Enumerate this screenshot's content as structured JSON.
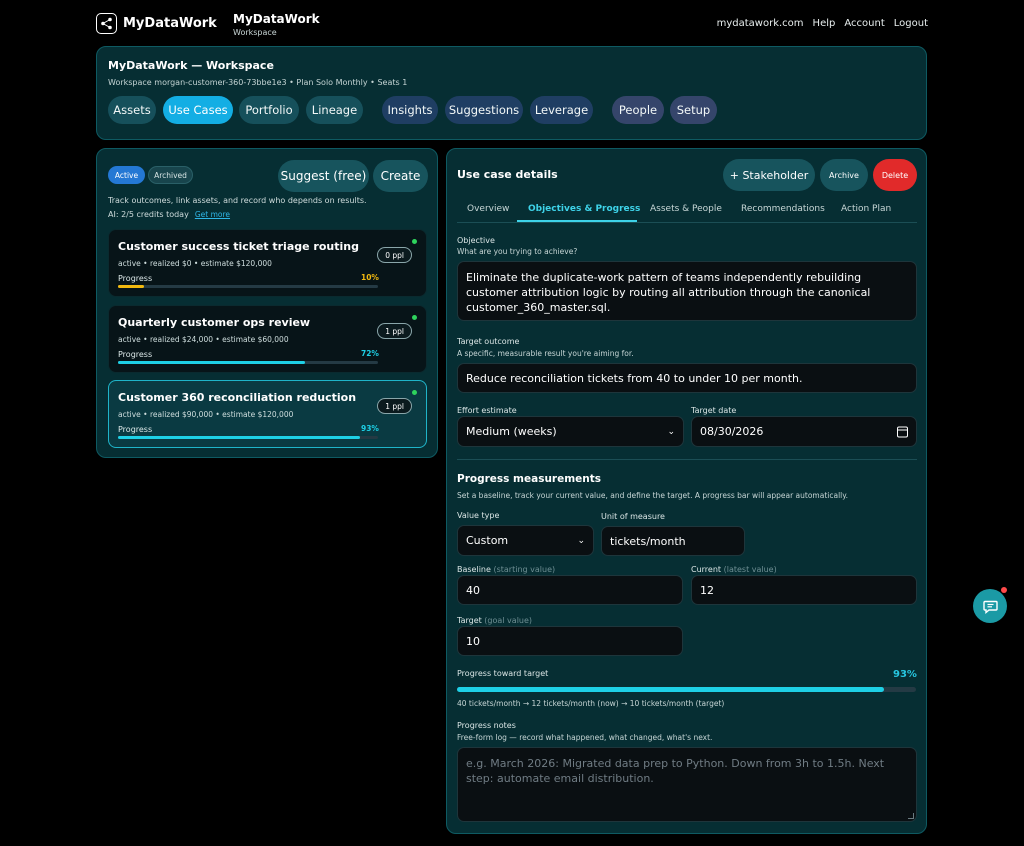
{
  "app": {
    "logo_text": "MyDataWork",
    "brand_title": "MyDataWork",
    "brand_sub": "Workspace"
  },
  "topnav": [
    "mydatawork.com",
    "Help",
    "Account",
    "Logout"
  ],
  "workspace": {
    "title": "MyDataWork — Workspace",
    "meta": "Workspace morgan-customer-360-73bbe1e3 • Plan Solo Monthly • Seats 1",
    "tabs": [
      "Assets",
      "Use Cases",
      "Portfolio",
      "Lineage",
      "Insights",
      "Suggestions",
      "Leverage",
      "People",
      "Setup"
    ],
    "active_tab": "Use Cases"
  },
  "left": {
    "chip_active": "Active",
    "chip_archived": "Archived",
    "suggest_label": "Suggest (free)",
    "create_label": "Create",
    "help_text": "Track outcomes, link assets, and record who depends on results.",
    "credits_text": "AI: 2/5 credits today",
    "get_more": "Get more",
    "cards": [
      {
        "title": "Customer success ticket triage routing",
        "sub": "active • realized $0 • estimate $120,000",
        "progress_label": "Progress",
        "pct_label": "10%",
        "progress": 0.1,
        "ppl": "0 ppl",
        "color": "#f2b90f"
      },
      {
        "title": "Quarterly customer ops review",
        "sub": "active • realized $24,000 • estimate $60,000",
        "progress_label": "Progress",
        "pct_label": "72%",
        "progress": 0.72,
        "ppl": "1 ppl",
        "color": "#1ed0e6"
      },
      {
        "title": "Customer 360 reconciliation reduction",
        "sub": "active • realized $90,000 • estimate $120,000",
        "progress_label": "Progress",
        "pct_label": "93%",
        "progress": 0.93,
        "ppl": "1 ppl",
        "color": "#1ed0e6"
      }
    ]
  },
  "details": {
    "title": "Use case details",
    "stakeholder_label": "+ Stakeholder",
    "archive_label": "Archive",
    "delete_label": "Delete",
    "subtabs": [
      "Overview",
      "Objectives & Progress",
      "Assets & People",
      "Recommendations",
      "Action Plan"
    ],
    "active_subtab": "Objectives & Progress",
    "objective_label": "Objective",
    "objective_help": "What are you trying to achieve?",
    "objective_value": "Eliminate the duplicate-work pattern of teams independently rebuilding customer attribution logic by routing all attribution through the canonical customer_360_master.sql.",
    "target_outcome_label": "Target outcome",
    "target_outcome_help": "A specific, measurable result you're aiming for.",
    "target_outcome_value": "Reduce reconciliation tickets from 40 to under 10 per month.",
    "effort_label": "Effort estimate",
    "effort_value": "Medium (weeks)",
    "target_date_label": "Target date",
    "target_date_value": "08/30/2026",
    "progress_title": "Progress measurements",
    "progress_help": "Set a baseline, track your current value, and define the target. A progress bar will appear automatically.",
    "value_type_label": "Value type",
    "value_type_value": "Custom",
    "unit_label": "Unit of measure",
    "unit_value": "tickets/month",
    "baseline_label": "Baseline",
    "baseline_hint": "(starting value)",
    "baseline_value": "40",
    "current_label": "Current",
    "current_hint": "(latest value)",
    "current_value": "12",
    "target_label": "Target",
    "target_hint": "(goal value)",
    "target_value": "10",
    "toward_label": "Progress toward target",
    "toward_pct_label": "93%",
    "toward_progress": 0.93,
    "toward_summary": "40 tickets/month → 12 tickets/month (now) → 10 tickets/month (target)",
    "notes_label": "Progress notes",
    "notes_help": "Free-form log — record what happened, what changed, what's next.",
    "notes_placeholder": "e.g. March 2026: Migrated data prep to Python. Down from 3h to 1.5h. Next step: automate email distribution."
  },
  "colors": {
    "accent": "#13aee4",
    "panel": "#062e33",
    "progress": "#1ed0e6",
    "delete": "#e12a2a"
  }
}
